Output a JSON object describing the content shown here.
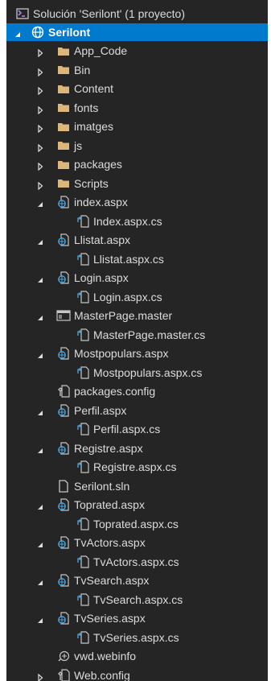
{
  "solution": {
    "title": "Solución 'Serilont'  (1 proyecto)"
  },
  "project": {
    "name": "Serilont"
  },
  "items": [
    {
      "label": "App_Code",
      "type": "folder",
      "expander": "collapsed",
      "depth": 1
    },
    {
      "label": "Bin",
      "type": "folder",
      "expander": "collapsed",
      "depth": 1
    },
    {
      "label": "Content",
      "type": "folder",
      "expander": "collapsed",
      "depth": 1
    },
    {
      "label": "fonts",
      "type": "folder",
      "expander": "collapsed",
      "depth": 1
    },
    {
      "label": "imatges",
      "type": "folder",
      "expander": "collapsed",
      "depth": 1
    },
    {
      "label": "js",
      "type": "folder",
      "expander": "collapsed",
      "depth": 1
    },
    {
      "label": "packages",
      "type": "folder",
      "expander": "collapsed",
      "depth": 1
    },
    {
      "label": "Scripts",
      "type": "folder",
      "expander": "collapsed",
      "depth": 1
    },
    {
      "label": "index.aspx",
      "type": "aspx",
      "expander": "expanded",
      "depth": 1
    },
    {
      "label": "Index.aspx.cs",
      "type": "cs",
      "expander": "none",
      "depth": 2
    },
    {
      "label": "Llistat.aspx",
      "type": "aspx",
      "expander": "expanded",
      "depth": 1
    },
    {
      "label": "Llistat.aspx.cs",
      "type": "cs",
      "expander": "none",
      "depth": 2
    },
    {
      "label": "Login.aspx",
      "type": "aspx",
      "expander": "expanded",
      "depth": 1
    },
    {
      "label": "Login.aspx.cs",
      "type": "cs",
      "expander": "none",
      "depth": 2
    },
    {
      "label": "MasterPage.master",
      "type": "master",
      "expander": "expanded",
      "depth": 1
    },
    {
      "label": "MasterPage.master.cs",
      "type": "cs",
      "expander": "none",
      "depth": 2
    },
    {
      "label": "Mostpopulars.aspx",
      "type": "aspx",
      "expander": "expanded",
      "depth": 1
    },
    {
      "label": "Mostpopulars.aspx.cs",
      "type": "cs",
      "expander": "none",
      "depth": 2
    },
    {
      "label": "packages.config",
      "type": "config",
      "expander": "none",
      "depth": 1
    },
    {
      "label": "Perfil.aspx",
      "type": "aspx",
      "expander": "expanded",
      "depth": 1
    },
    {
      "label": "Perfil.aspx.cs",
      "type": "cs",
      "expander": "none",
      "depth": 2
    },
    {
      "label": "Registre.aspx",
      "type": "aspx",
      "expander": "expanded",
      "depth": 1
    },
    {
      "label": "Registre.aspx.cs",
      "type": "cs",
      "expander": "none",
      "depth": 2
    },
    {
      "label": "Serilont.sln",
      "type": "file",
      "expander": "none",
      "depth": 1
    },
    {
      "label": "Toprated.aspx",
      "type": "aspx",
      "expander": "expanded",
      "depth": 1
    },
    {
      "label": "Toprated.aspx.cs",
      "type": "cs",
      "expander": "none",
      "depth": 2
    },
    {
      "label": "TvActors.aspx",
      "type": "aspx",
      "expander": "expanded",
      "depth": 1
    },
    {
      "label": "TvActors.aspx.cs",
      "type": "cs",
      "expander": "none",
      "depth": 2
    },
    {
      "label": "TvSearch.aspx",
      "type": "aspx",
      "expander": "expanded",
      "depth": 1
    },
    {
      "label": "TvSearch.aspx.cs",
      "type": "cs",
      "expander": "none",
      "depth": 2
    },
    {
      "label": "TvSeries.aspx",
      "type": "aspx",
      "expander": "expanded",
      "depth": 1
    },
    {
      "label": "TvSeries.aspx.cs",
      "type": "cs",
      "expander": "none",
      "depth": 2
    },
    {
      "label": "vwd.webinfo",
      "type": "webinfo",
      "expander": "none",
      "depth": 1
    },
    {
      "label": "Web.config",
      "type": "config",
      "expander": "collapsed",
      "depth": 1
    }
  ],
  "colors": {
    "panel_bg": "#252526",
    "text": "#dcdcdc",
    "selection": "#007acc",
    "folder": "#dcb67a",
    "icon": "#c5c5c5",
    "globe": "#4fa8e0",
    "solution": "#68217a"
  }
}
